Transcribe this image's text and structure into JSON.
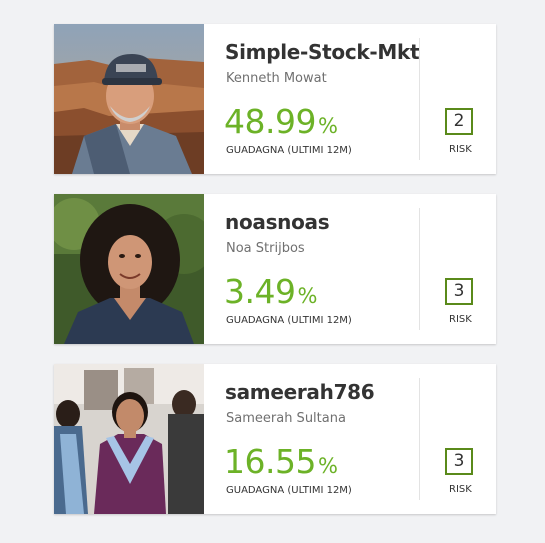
{
  "cards": [
    {
      "username": "Simple-Stock-Mkt",
      "fullname": "Kenneth Mowat",
      "gain_value": "48.99",
      "gain_unit": "%",
      "gain_label": "GUADAGNA (ULTIMI 12M)",
      "risk_value": "2",
      "risk_label": "RISK",
      "photo": "avatar-man-canyon",
      "accent_color": "#6cb227"
    },
    {
      "username": "noasnoas",
      "fullname": "Noa Strijbos",
      "gain_value": "3.49",
      "gain_unit": "%",
      "gain_label": "GUADAGNA (ULTIMI 12M)",
      "risk_value": "3",
      "risk_label": "RISK",
      "photo": "avatar-woman-curly-hair",
      "accent_color": "#6cb227"
    },
    {
      "username": "sameerah786",
      "fullname": "Sameerah Sultana",
      "gain_value": "16.55",
      "gain_unit": "%",
      "gain_label": "GUADAGNA (ULTIMI 12M)",
      "risk_value": "3",
      "risk_label": "RISK",
      "photo": "avatar-woman-event",
      "accent_color": "#6cb227"
    }
  ]
}
